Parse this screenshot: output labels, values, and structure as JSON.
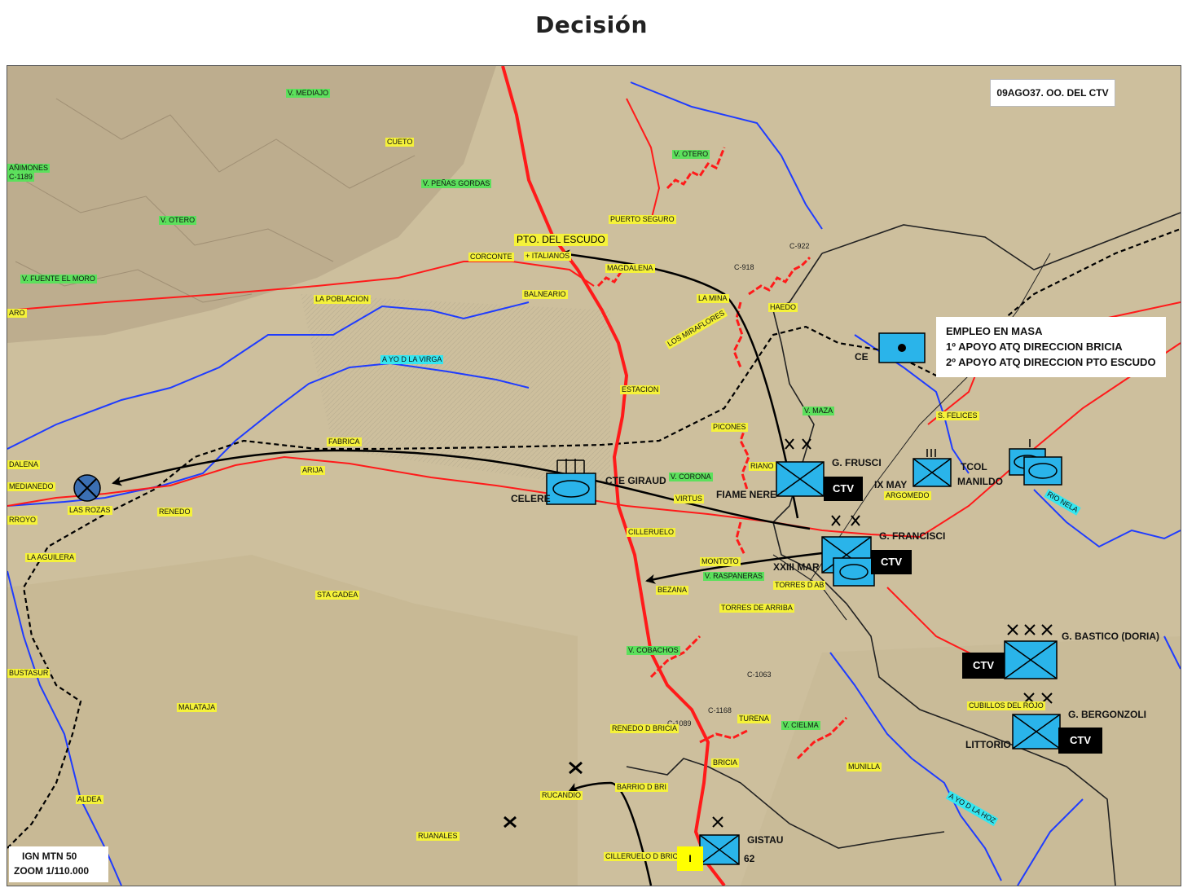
{
  "title": "Decisión",
  "header_note": "09AGO37. OO. DEL CTV",
  "notes": {
    "line1": "EMPLEO EN MASA",
    "line2": "1º APOYO ATQ DIRECCION BRICIA",
    "line3": "2º APOYO ATQ DIRECCION PTO ESCUDO"
  },
  "footer": {
    "line1": "IGN MTN 50",
    "line2": "ZOOM 1/110.000"
  },
  "place_labels": [
    {
      "text": "V. MEDIAJO",
      "style": "lg"
    },
    {
      "text": "CUETO",
      "style": "ly"
    },
    {
      "text": "AÑIMONES",
      "style": "lg"
    },
    {
      "text": "C-1189",
      "style": "lg"
    },
    {
      "text": "V. PEÑAS GORDAS",
      "style": "lg"
    },
    {
      "text": "V. OTERO",
      "style": "lg"
    },
    {
      "text": "V. OTERO",
      "style": "lg"
    },
    {
      "text": "PUERTO SEGURO",
      "style": "ly"
    },
    {
      "text": "CORCONTE",
      "style": "ly"
    },
    {
      "text": "+ ITALIANOS",
      "style": "ly"
    },
    {
      "text": "MAGDALENA",
      "style": "ly"
    },
    {
      "text": "V. FUENTE EL MORO",
      "style": "lg"
    },
    {
      "text": "LA POBLACION",
      "style": "ly"
    },
    {
      "text": "BALNEARIO",
      "style": "ly"
    },
    {
      "text": "C-918",
      "style": "plain"
    },
    {
      "text": "C-922",
      "style": "plain"
    },
    {
      "text": "LA MINA",
      "style": "ly"
    },
    {
      "text": "LOS MIRAFLORES",
      "style": "ly"
    },
    {
      "text": "HAEDO",
      "style": "ly"
    },
    {
      "text": "ARO",
      "style": "ly"
    },
    {
      "text": "A YO D LA VIRGA",
      "style": "lc"
    },
    {
      "text": "ESTACION",
      "style": "ly"
    },
    {
      "text": "V. MAZA",
      "style": "lg"
    },
    {
      "text": "S. FELICES",
      "style": "ly"
    },
    {
      "text": "PICONES",
      "style": "ly"
    },
    {
      "text": "DALENA",
      "style": "ly"
    },
    {
      "text": "MEDIANEDO",
      "style": "ly"
    },
    {
      "text": "FABRICA",
      "style": "ly"
    },
    {
      "text": "ARIJA",
      "style": "ly"
    },
    {
      "text": "V. CORONA",
      "style": "lg"
    },
    {
      "text": "RIANO",
      "style": "ly"
    },
    {
      "text": "VIRTUS",
      "style": "ly"
    },
    {
      "text": "ARGOMEDO",
      "style": "ly"
    },
    {
      "text": "RIO NELA",
      "style": "lc"
    },
    {
      "text": "LAS ROZAS",
      "style": "ly"
    },
    {
      "text": "RENEDO",
      "style": "ly"
    },
    {
      "text": "RROYO",
      "style": "ly"
    },
    {
      "text": "CILLERUELO",
      "style": "ly"
    },
    {
      "text": "LA AGUILERA",
      "style": "ly"
    },
    {
      "text": "MONTOTO",
      "style": "ly"
    },
    {
      "text": "V. RASPANERAS",
      "style": "lg"
    },
    {
      "text": "BEZANA",
      "style": "ly"
    },
    {
      "text": "TORRES D AB",
      "style": "ly"
    },
    {
      "text": "TORRES DE ARRIBA",
      "style": "ly"
    },
    {
      "text": "STA GADEA",
      "style": "ly"
    },
    {
      "text": "V. COBACHOS",
      "style": "lg"
    },
    {
      "text": "BUSTASUR",
      "style": "ly"
    },
    {
      "text": "C-1063",
      "style": "plain"
    },
    {
      "text": "MALATAJA",
      "style": "ly"
    },
    {
      "text": "C-1168",
      "style": "plain"
    },
    {
      "text": "TURENA",
      "style": "ly"
    },
    {
      "text": "V. CIELMA",
      "style": "lg"
    },
    {
      "text": "C-1089",
      "style": "plain"
    },
    {
      "text": "RENEDO D BRICIA",
      "style": "ly"
    },
    {
      "text": "CUBILLOS DEL ROJO",
      "style": "ly"
    },
    {
      "text": "BRICIA",
      "style": "ly"
    },
    {
      "text": "MUNILLA",
      "style": "ly"
    },
    {
      "text": "BARRIO D BRI",
      "style": "ly"
    },
    {
      "text": "RUCANDIO",
      "style": "ly"
    },
    {
      "text": "ALDEA",
      "style": "ly"
    },
    {
      "text": "RUANALES",
      "style": "ly"
    },
    {
      "text": "CILLERUELO D BRICIA",
      "style": "ly"
    },
    {
      "text": "A YO D LA HOZ",
      "style": "lc"
    }
  ],
  "pto_label": "PTO. DEL ESCUDO",
  "units": {
    "celere": "CELERE",
    "giraud": "CTE GIRAUD",
    "ce": "CE",
    "frusci": "G. FRUSCI",
    "fiame": "FIAME NERE",
    "ixmay": "IX MAY",
    "tcol": "TCOL",
    "manildo": "MANILDO",
    "francisci": "G. FRANCISCI",
    "xxiii": "XXIII MAR",
    "bastico": "G. BASTICO (DORIA)",
    "bergonzoli": "G. BERGONZOLI",
    "littorio": "LITTORIO",
    "gistau": "GISTAU",
    "gistau_num": "62",
    "gistau_tag": "I",
    "ctv": "CTV"
  },
  "colors": {
    "map_bg": "#cdbf9d",
    "road_red": "#ff1a1a",
    "river_blue": "#1f3cff",
    "unit_fill": "#2ab4ea",
    "label_yellow": "#f5f23a",
    "label_green": "#5ce05c",
    "label_cyan": "#35e6f0"
  }
}
